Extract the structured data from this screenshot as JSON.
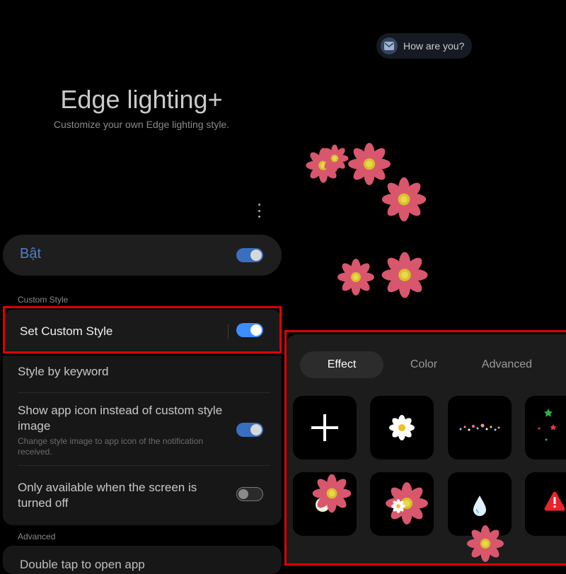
{
  "header": {
    "title": "Edge lighting+",
    "subtitle": "Customize your own Edge lighting style."
  },
  "master_switch": {
    "label": "Bật",
    "state": "on"
  },
  "sections": {
    "custom_style": "Custom Style",
    "advanced": "Advanced"
  },
  "custom_style_row": {
    "label": "Set Custom Style",
    "state": "on"
  },
  "settings_rows": [
    {
      "title": "Style by keyword"
    },
    {
      "title": "Show app icon instead of custom style image",
      "subtitle": "Change style image to app icon of the notification received.",
      "state": "on"
    },
    {
      "title": "Only available when the screen is turned off",
      "state": "off"
    }
  ],
  "next_row": {
    "label": "Double tap to open app"
  },
  "notification": {
    "text": "How are you?",
    "icon": "mail-icon"
  },
  "tabs": [
    {
      "label": "Effect",
      "active": true
    },
    {
      "label": "Color",
      "active": false
    },
    {
      "label": "Advanced",
      "active": false
    }
  ],
  "effect_tiles": [
    {
      "icon": "add-icon"
    },
    {
      "icon": "white-daisy-icon"
    },
    {
      "icon": "confetti-icon"
    },
    {
      "icon": "stars-icon"
    },
    {
      "icon": "pink-flower-icon"
    },
    {
      "icon": "pink-flowers-icon"
    },
    {
      "icon": "water-drop-icon"
    },
    {
      "icon": "alert-icon"
    }
  ],
  "colors": {
    "accent": "#3f8cff",
    "highlight": "#e00000",
    "flower_petal": "#d9576d",
    "flower_center": "#d6c22a"
  }
}
